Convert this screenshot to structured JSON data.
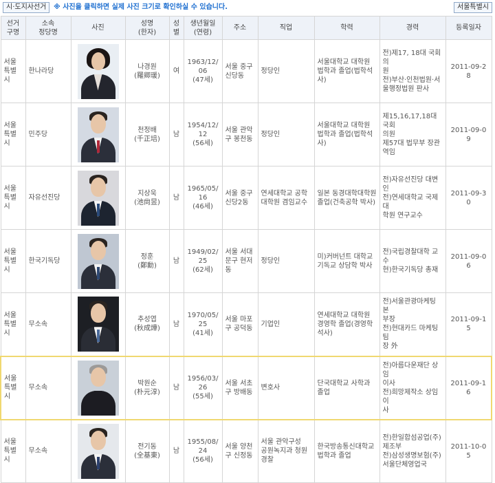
{
  "header": {
    "election_type": "시·도지사선거",
    "notice_mark": "※",
    "notice_text": "사진을 클릭하면 실제 사진 크기로 확인하실 수 있습니다.",
    "region": "서울특별시"
  },
  "columns": [
    "선거\n구명",
    "소속\n정당명",
    "사진",
    "성명\n(한자)",
    "성\n별",
    "생년월일\n(연령)",
    "주소",
    "직업",
    "학력",
    "경력",
    "등록일자"
  ],
  "candidates": [
    {
      "district": "서울\n특별\n시",
      "party": "한나라당",
      "photo": "portrait-photo",
      "name": "나경원\n(羅卿瑗)",
      "gender": "여",
      "birth": "1963/12/06\n(47세)",
      "address": "서울 중구\n신당동",
      "job": "정당인",
      "education": "서울대학교 대학원\n법학과 졸업(법학석\n사)",
      "career": "전)제17, 18대 국회의\n원\n전)부산·인천법원·서\n울행정법원 판사",
      "registered": "2011-09-28"
    },
    {
      "district": "서울\n특별\n시",
      "party": "민주당",
      "photo": "portrait-photo",
      "name": "천정배\n(千正培)",
      "gender": "남",
      "birth": "1954/12/12\n(56세)",
      "address": "서울 관악\n구 봉천동",
      "job": "정당인",
      "education": "서울대학교 대학원\n법학과 졸업(법학석\n사)",
      "career": "제15,16,17,18대 국회\n의원\n제57대 법무부 장관\n역임",
      "registered": "2011-09-09"
    },
    {
      "district": "서울\n특별\n시",
      "party": "자유선진당",
      "photo": "portrait-photo",
      "name": "지상욱\n(池尙昱)",
      "gender": "남",
      "birth": "1965/05/16\n(46세)",
      "address": "서울 중구\n신당2동",
      "job": "연세대학교 공학\n대학원 겸임교수",
      "education": "일본 동경대학대학원\n졸업(건축공학 박사)",
      "career": "전)자유선진당 대변인\n전)연세대학교 국제대\n학원 연구교수",
      "registered": "2011-09-30"
    },
    {
      "district": "서울\n특별\n시",
      "party": "한국기독당",
      "photo": "portrait-photo",
      "name": "정훈\n(鄭勳)",
      "gender": "남",
      "birth": "1949/02/25\n(62세)",
      "address": "서울 서대\n문구 현저\n동",
      "job": "정당인",
      "education": "미)커버넌트 대학교\n기독교 상담학 박사",
      "career": "전)국립경찰대학 교수\n현)한국기독당 총재",
      "registered": "2011-09-06"
    },
    {
      "district": "서울\n특별\n시",
      "party": "무소속",
      "photo": "portrait-photo",
      "name": "추성엽\n(秋成燁)",
      "gender": "남",
      "birth": "1970/05/25\n(41세)",
      "address": "서울 마포\n구 공덕동",
      "job": "기업인",
      "education": "연세대학교 대학원\n경영학 졸업(경영학\n석사)",
      "career": "전)서울관광마케팅 본\n부장\n전)현대카드 마케팅팀\n장 外",
      "registered": "2011-09-15"
    },
    {
      "district": "서울\n특별\n시",
      "party": "무소속",
      "photo": "portrait-photo",
      "name": "박원순\n(朴元淳)",
      "gender": "남",
      "birth": "1956/03/26\n(55세)",
      "address": "서울 서초\n구 방배동",
      "job": "변호사",
      "education": "단국대학교 사학과\n졸업",
      "career": "전)아름다운재단 상임\n이사\n전)희망제작소 상임이\n사",
      "registered": "2011-09-16"
    },
    {
      "district": "서울\n특별\n시",
      "party": "무소속",
      "photo": "portrait-photo",
      "name": "전기동\n(全基東)",
      "gender": "남",
      "birth": "1955/08/24\n(56세)",
      "address": "서울 양천\n구 신정동",
      "job": "서울 관악구성\n공원녹지과 청원\n경찰",
      "education": "한국방송통신대학교\n법학과 졸업",
      "career": "전)한일합섬공업(주)\n제조부\n전)삼성생명보험(주)\n서울단체영업국",
      "registered": "2011-10-05"
    }
  ],
  "highlighted_row": 5,
  "colors": {
    "header_bg": "#eef2f8",
    "notice_text": "#1e6fd0",
    "highlight_border": "#f0d870",
    "grid_line": "#d5d5d5"
  }
}
